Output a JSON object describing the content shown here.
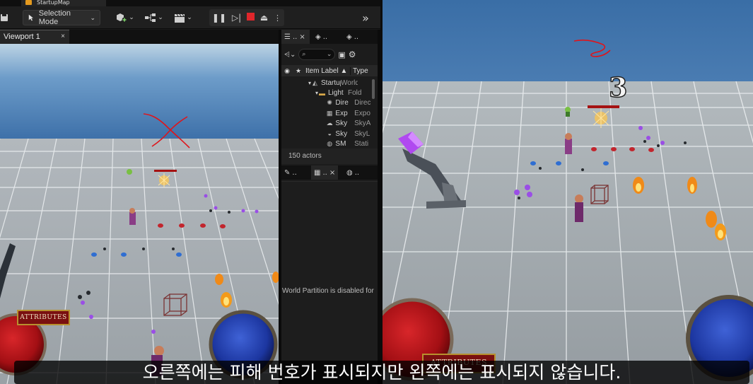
{
  "editor": {
    "map_tab": "StartupMap",
    "toolbar": {
      "selection_mode": "Selection Mode"
    },
    "viewport_tab": {
      "label": "Viewport 1",
      "close": "×"
    },
    "outliner": {
      "tab1_label": "..",
      "tab1_close": "×",
      "tab2_label": "..",
      "tab3_label": "..",
      "col_item_label": "Item Label ▲",
      "col_type": "Type",
      "rows": [
        {
          "label": "Startup",
          "type": "World"
        },
        {
          "label": "Light",
          "type": "Fold"
        },
        {
          "label": "Dire",
          "type": "Direc"
        },
        {
          "label": "Exp",
          "type": "Expo"
        },
        {
          "label": "Sky",
          "type": "SkyA"
        },
        {
          "label": "Sky",
          "type": "SkyL"
        },
        {
          "label": "SM",
          "type": "Stati"
        }
      ],
      "actor_count": "150 actors"
    },
    "details": {
      "tab1_label": "..",
      "tab2_label": "..",
      "tab2_close": "×",
      "tab3_label": "..",
      "world_partition_msg": "World Partition is disabled for"
    }
  },
  "left_game": {
    "attributes_button": "ATTRIBUTES"
  },
  "right_game": {
    "damage_number": "3",
    "attributes_button": "ATTRIBUTES"
  },
  "subtitle": "오른쪽에는 피해 번호가 표시되지만 왼쪽에는 표시되지 않습니다.",
  "colors": {
    "sky": "#3a6ea6",
    "floor": "#a9b0b5",
    "health_orb": "#b01015",
    "mana_orb": "#1f3fa8",
    "stop": "#e0262b",
    "annotation_red": "#e0141a"
  }
}
